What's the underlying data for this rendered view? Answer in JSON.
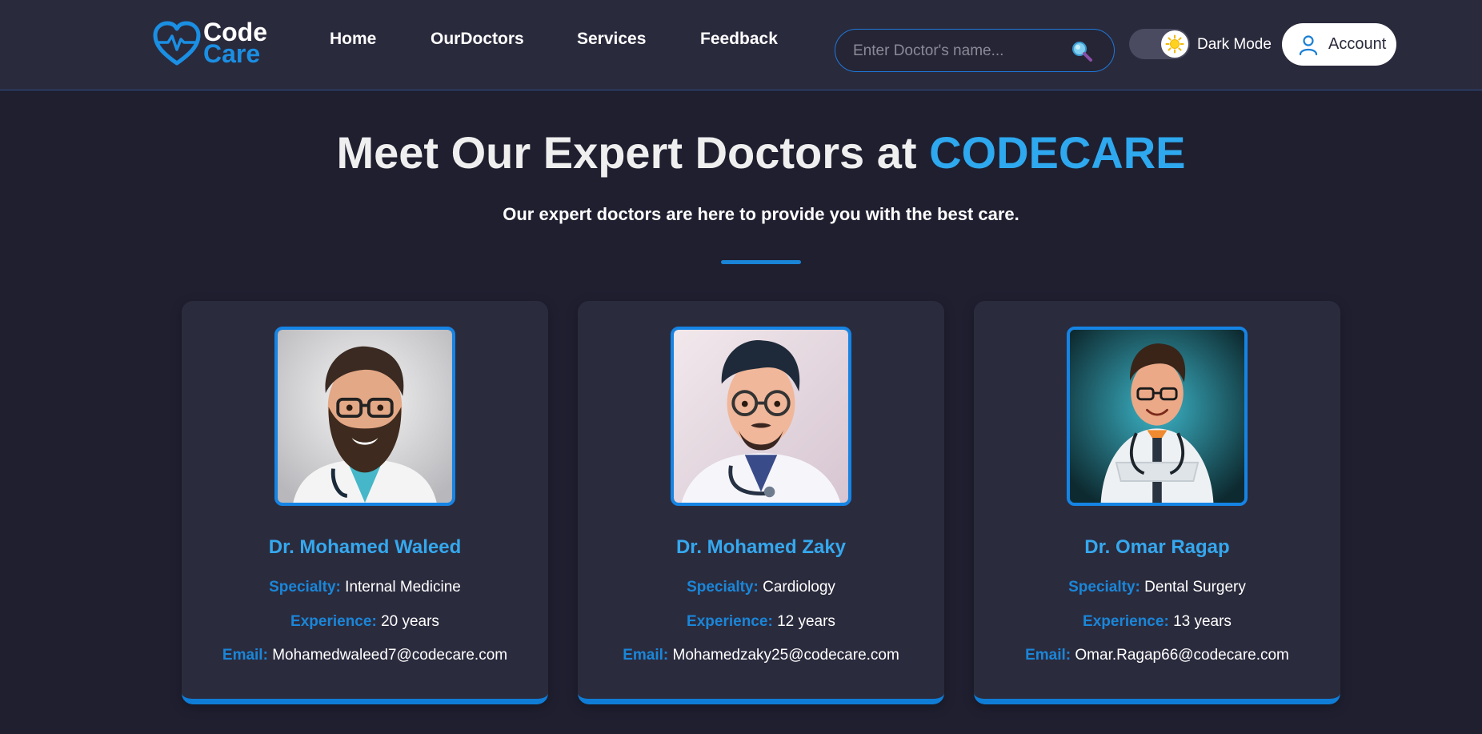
{
  "brand": {
    "line1": "Code",
    "line2": "Care"
  },
  "nav": {
    "items": [
      {
        "label": "Home"
      },
      {
        "label": "OurDoctors"
      },
      {
        "label": "Services"
      },
      {
        "label": "Feedback"
      }
    ]
  },
  "search": {
    "placeholder": "Enter Doctor's name...",
    "value": "",
    "icon": "search-icon"
  },
  "theme": {
    "label": "Dark Mode",
    "icon": "sun-icon",
    "enabled": true
  },
  "account": {
    "label": "Account",
    "icon": "user-icon"
  },
  "hero": {
    "title": "Meet Our Expert Doctors at ",
    "title_accent": "CODECARE",
    "subtitle": "Our expert doctors are here to provide you with the best care."
  },
  "labels": {
    "specialty": "Specialty:",
    "experience": "Experience:",
    "email": "Email:"
  },
  "doctors": [
    {
      "name": "Dr. Mohamed Waleed",
      "specialty": "Internal Medicine",
      "experience": "20 years",
      "email": "Mohamedwaleed7@codecare.com"
    },
    {
      "name": "Dr. Mohamed Zaky",
      "specialty": "Cardiology",
      "experience": "12 years",
      "email": "Mohamedzaky25@codecare.com"
    },
    {
      "name": "Dr. Omar Ragap",
      "specialty": "Dental Surgery",
      "experience": "13 years",
      "email": "Omar.Ragap66@codecare.com"
    }
  ],
  "colors": {
    "background": "#1f1f30",
    "navbar": "#2a2a3d",
    "card": "#2b2b3e",
    "accent": "#2ea8ee",
    "accent_dark": "#1a86d8"
  }
}
